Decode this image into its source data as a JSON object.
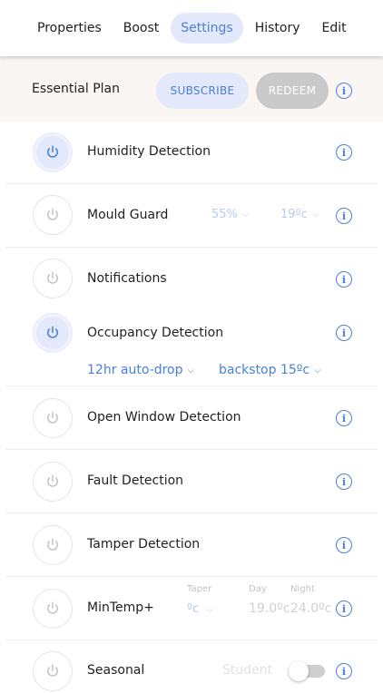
{
  "nav": {
    "tabs": [
      {
        "label": "Properties",
        "active": false
      },
      {
        "label": "Boost",
        "active": false
      },
      {
        "label": "Settings",
        "active": true
      },
      {
        "label": "History",
        "active": false
      },
      {
        "label": "Edit",
        "active": false
      }
    ]
  },
  "plan": {
    "title": "Essential Plan",
    "subscribe_label": "SUBSCRIBE",
    "redeem_label": "REDEEM"
  },
  "features": {
    "humidity": {
      "label": "Humidity Detection",
      "on": true
    },
    "mould": {
      "label": "Mould Guard",
      "on": false,
      "humidity_value": "55%",
      "temp_value": "19ºc"
    },
    "notifications": {
      "label": "Notifications",
      "on": false
    },
    "occupancy": {
      "label": "Occupancy Detection",
      "on": true,
      "autodrop_value": "12hr auto-drop",
      "backstop_value": "backstop 15ºc"
    },
    "open_window": {
      "label": "Open Window Detection",
      "on": false
    },
    "fault": {
      "label": "Fault Detection",
      "on": false
    },
    "tamper": {
      "label": "Tamper Detection",
      "on": false
    },
    "mintemp": {
      "label": "MinTemp+",
      "on": false,
      "taper_label": "Taper",
      "taper_value": "ºc",
      "day_label": "Day",
      "day_value": "19.0ºc",
      "night_label": "Night",
      "night_value": "24.0ºc"
    },
    "seasonal": {
      "label": "Seasonal",
      "on": false,
      "mode_label": "Student",
      "toggle_on": false
    }
  },
  "icons": {
    "power": "power-icon",
    "info": "info-icon",
    "chevron": "chevron-down-icon"
  },
  "colors": {
    "accent": "#4a7fd6",
    "accent_soft": "#e3e8fb",
    "plan_bg": "#faf6f3",
    "redeem_bg": "#c9c9c9"
  }
}
